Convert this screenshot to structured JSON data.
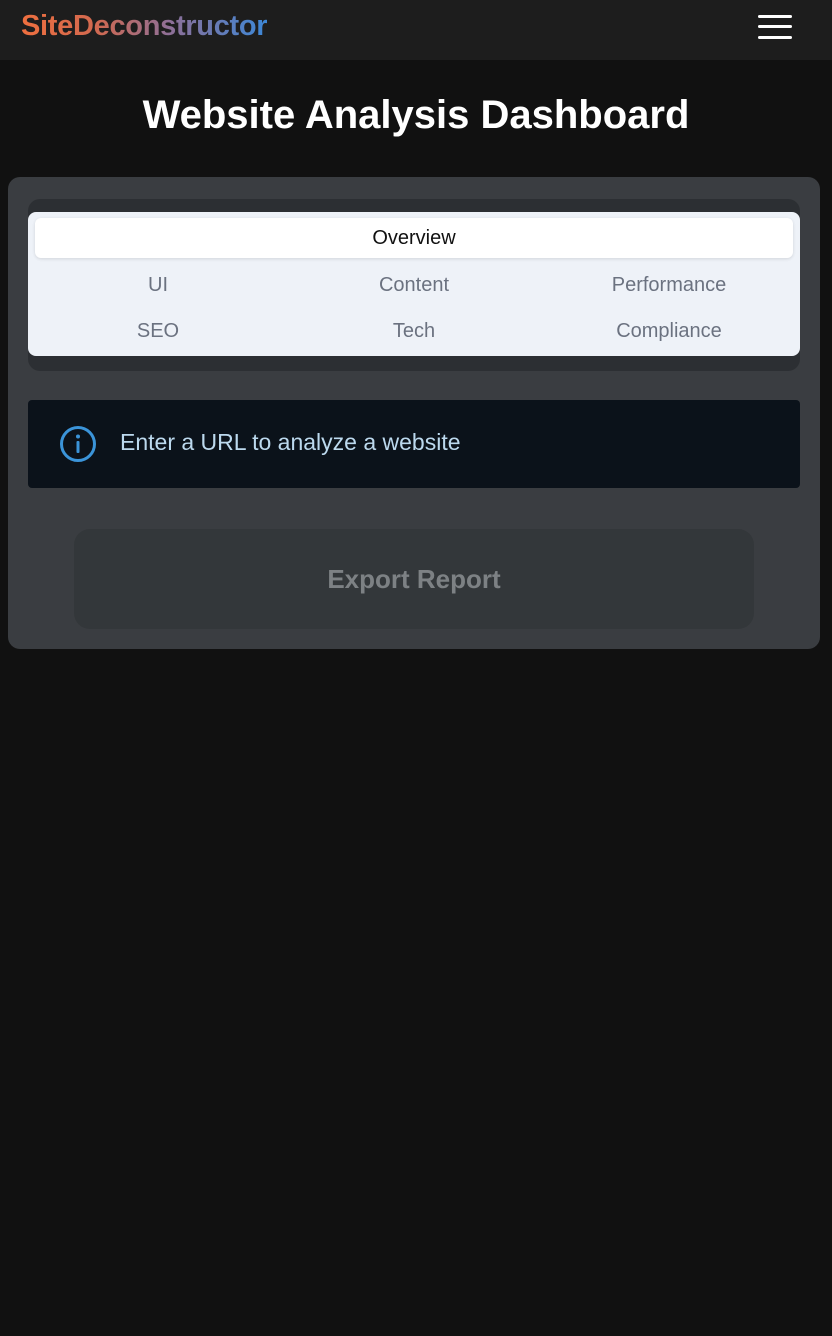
{
  "header": {
    "brand": "SiteDeconstructor",
    "menu_icon": "hamburger-menu-icon"
  },
  "page": {
    "title": "Website Analysis Dashboard"
  },
  "tabs": {
    "active": "Overview",
    "items": [
      {
        "label": "Overview"
      },
      {
        "label": "UI"
      },
      {
        "label": "Content"
      },
      {
        "label": "Performance"
      },
      {
        "label": "SEO"
      },
      {
        "label": "Tech"
      },
      {
        "label": "Compliance"
      }
    ]
  },
  "alert": {
    "icon": "info-icon",
    "message": "Enter a URL to analyze a website"
  },
  "actions": {
    "export_label": "Export Report"
  },
  "colors": {
    "background": "#111111",
    "topbar": "#1d1d1d",
    "card": "#3a3d41",
    "tabs_bg": "#eef2f8",
    "alert_bg": "#0b121a",
    "info_accent": "#3b94d9",
    "brand_gradient_start": "#ee6f3f",
    "brand_gradient_end": "#3d87d6"
  }
}
